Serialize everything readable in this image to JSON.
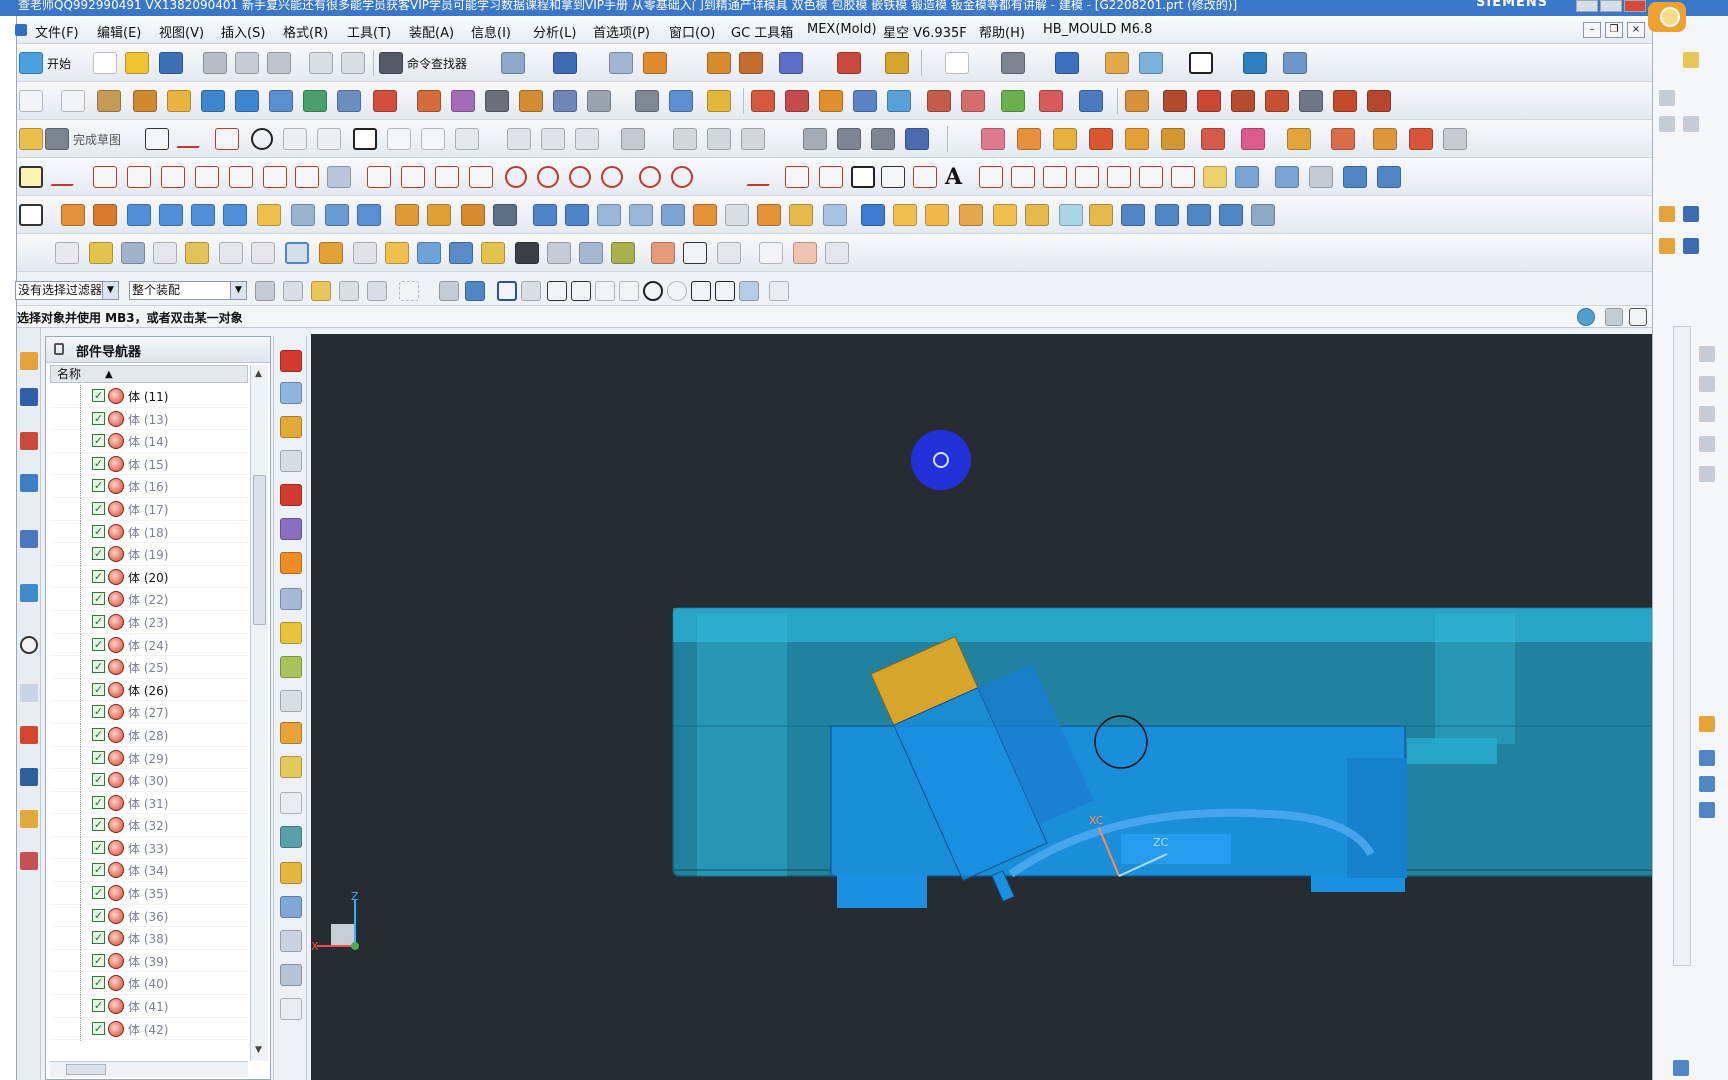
{
  "title_bar": {
    "text": "查老师QQ992990491 VX1382090401 新手复兴能还有很多能学员获客VIP学员可能学习数据课程和拿到VIP手册 从零基础入门到精通产详模具 双色模 包胶模 嵌铁模 锻造模 钣金模等都有讲解 - 建模 - [G2208201.prt (修改的)]",
    "brand": "SIEMENS"
  },
  "menu": {
    "items": [
      "文件(F)",
      "编辑(E)",
      "视图(V)",
      "插入(S)",
      "格式(R)",
      "工具(T)",
      "装配(A)",
      "信息(I)",
      "分析(L)",
      "首选项(P)",
      "窗口(O)",
      "GC 工具箱",
      "MEX(Mold)",
      "星空 V6.935F",
      "帮助(H)",
      "HB_MOULD M6.8"
    ]
  },
  "toolbar": {
    "start_label": "开始",
    "command_finder_label": "命令查找器",
    "finish_sketch_label": "完成草图"
  },
  "selection_bar": {
    "filter_value": "没有选择过滤器",
    "scope_value": "整个装配"
  },
  "cue_line": {
    "text": "选择对象并使用 MB3，或者双击某一对象"
  },
  "navigator": {
    "title": "部件导航器",
    "column_name": "名称",
    "rows": [
      {
        "label": "体 (11)",
        "active": true
      },
      {
        "label": "体 (13)",
        "active": false
      },
      {
        "label": "体 (14)",
        "active": false
      },
      {
        "label": "体 (15)",
        "active": false
      },
      {
        "label": "体 (16)",
        "active": false
      },
      {
        "label": "体 (17)",
        "active": false
      },
      {
        "label": "体 (18)",
        "active": false
      },
      {
        "label": "体 (19)",
        "active": false
      },
      {
        "label": "体 (20)",
        "active": true
      },
      {
        "label": "体 (22)",
        "active": false
      },
      {
        "label": "体 (23)",
        "active": false
      },
      {
        "label": "体 (24)",
        "active": false
      },
      {
        "label": "体 (25)",
        "active": false
      },
      {
        "label": "体 (26)",
        "active": true
      },
      {
        "label": "体 (27)",
        "active": false
      },
      {
        "label": "体 (28)",
        "active": false
      },
      {
        "label": "体 (29)",
        "active": false
      },
      {
        "label": "体 (30)",
        "active": false
      },
      {
        "label": "体 (31)",
        "active": false
      },
      {
        "label": "体 (32)",
        "active": false
      },
      {
        "label": "体 (33)",
        "active": false
      },
      {
        "label": "体 (34)",
        "active": false
      },
      {
        "label": "体 (35)",
        "active": false
      },
      {
        "label": "体 (36)",
        "active": false
      },
      {
        "label": "体 (38)",
        "active": false
      },
      {
        "label": "体 (39)",
        "active": false
      },
      {
        "label": "体 (40)",
        "active": false
      },
      {
        "label": "体 (41)",
        "active": false
      },
      {
        "label": "体 (42)",
        "active": false
      }
    ]
  },
  "viewport": {
    "axis_labels": {
      "x": "X",
      "z": "Z",
      "zc": "ZC",
      "xc": "XC"
    },
    "colors": {
      "background": "#272c33",
      "mold_base": "#1ea4c7",
      "insert": "#1b8fe0",
      "slider": "#d7a52b",
      "cursor": "#2130d8"
    }
  }
}
